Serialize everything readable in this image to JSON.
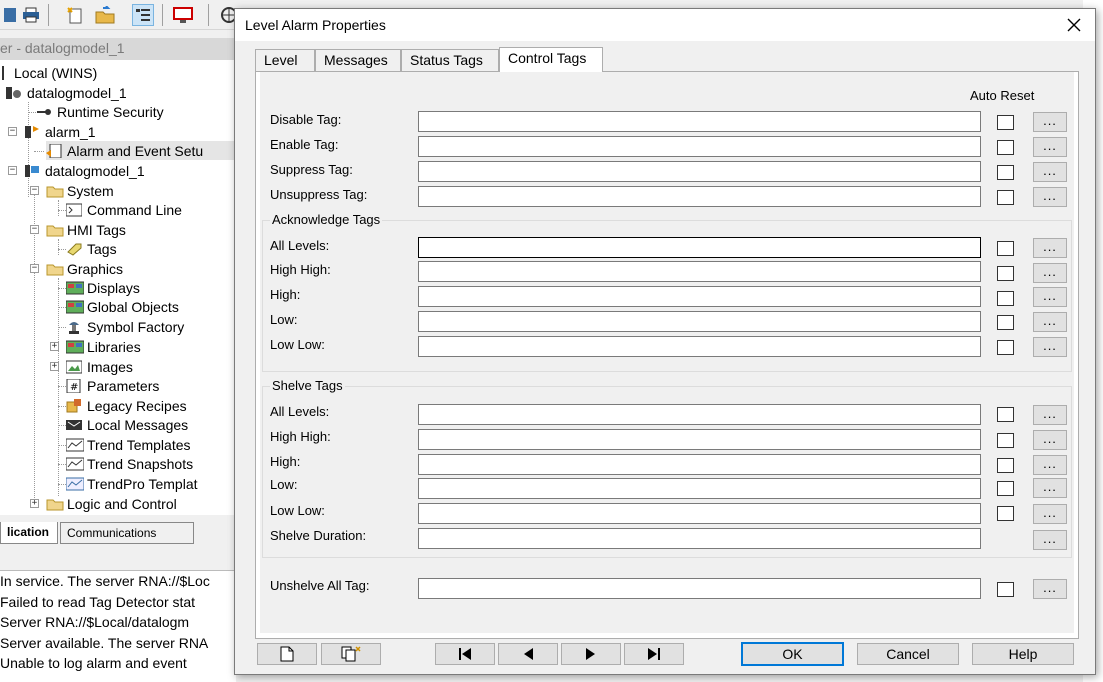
{
  "background": {
    "explorer_title": "er - datalogmodel_1",
    "tree": [
      {
        "key": "local",
        "label": "Local (WINS)"
      },
      {
        "key": "app",
        "label": "datalogmodel_1"
      },
      {
        "key": "runtime-security",
        "label": "Runtime Security"
      },
      {
        "key": "alarm",
        "label": "alarm_1"
      },
      {
        "key": "alarm-event",
        "label": "Alarm and Event Setu"
      },
      {
        "key": "area",
        "label": "datalogmodel_1"
      },
      {
        "key": "system",
        "label": "System"
      },
      {
        "key": "command-line",
        "label": "Command Line"
      },
      {
        "key": "hmi-tags",
        "label": "HMI Tags"
      },
      {
        "key": "tags",
        "label": "Tags"
      },
      {
        "key": "graphics",
        "label": "Graphics"
      },
      {
        "key": "displays",
        "label": "Displays"
      },
      {
        "key": "global-objects",
        "label": "Global Objects"
      },
      {
        "key": "symbol-factory",
        "label": "Symbol Factory"
      },
      {
        "key": "libraries",
        "label": "Libraries"
      },
      {
        "key": "images",
        "label": "Images"
      },
      {
        "key": "parameters",
        "label": "Parameters"
      },
      {
        "key": "legacy-recipes",
        "label": "Legacy Recipes"
      },
      {
        "key": "local-messages",
        "label": "Local Messages"
      },
      {
        "key": "trend-templates",
        "label": "Trend Templates"
      },
      {
        "key": "trend-snapshots",
        "label": "Trend Snapshots"
      },
      {
        "key": "trendpro-templates",
        "label": "TrendPro Templat"
      },
      {
        "key": "logic-control",
        "label": "Logic and Control"
      }
    ],
    "tabs": {
      "application": "lication",
      "communications": "Communications"
    },
    "diagnostics": [
      "In service. The server RNA://$Loc",
      "Failed to read Tag Detector stat",
      "Server RNA://$Local/datalogm",
      "Server available. The server RNA",
      "Unable to log alarm and event"
    ]
  },
  "dialog": {
    "title": "Level Alarm Properties",
    "tabs": [
      "Level",
      "Messages",
      "Status Tags",
      "Control Tags"
    ],
    "active_tab": "Control Tags",
    "auto_reset_label": "Auto Reset",
    "browse_label": "...",
    "control_fields": [
      {
        "label": "Disable Tag:",
        "value": "",
        "auto_reset": false
      },
      {
        "label": "Enable Tag:",
        "value": "",
        "auto_reset": false
      },
      {
        "label": "Suppress Tag:",
        "value": "",
        "auto_reset": false
      },
      {
        "label": "Unsuppress Tag:",
        "value": "",
        "auto_reset": false
      }
    ],
    "acknowledge_group": {
      "title": "Acknowledge Tags",
      "fields": [
        {
          "label": "All Levels:",
          "value": "",
          "auto_reset": false
        },
        {
          "label": "High High:",
          "value": "",
          "auto_reset": false
        },
        {
          "label": "High:",
          "value": "",
          "auto_reset": false
        },
        {
          "label": "Low:",
          "value": "",
          "auto_reset": false
        },
        {
          "label": "Low Low:",
          "value": "",
          "auto_reset": false
        }
      ]
    },
    "shelve_group": {
      "title": "Shelve Tags",
      "fields": [
        {
          "label": "All Levels:",
          "value": "",
          "auto_reset": false
        },
        {
          "label": "High High:",
          "value": "",
          "auto_reset": false
        },
        {
          "label": "High:",
          "value": "",
          "auto_reset": false
        },
        {
          "label": "Low:",
          "value": "",
          "auto_reset": false
        },
        {
          "label": "Low Low:",
          "value": "",
          "auto_reset": false
        }
      ],
      "duration_label": "Shelve Duration:",
      "duration_value": ""
    },
    "unshelve": {
      "label": "Unshelve All Tag:",
      "value": "",
      "auto_reset": false
    },
    "buttons": {
      "ok": "OK",
      "cancel": "Cancel",
      "help": "Help"
    }
  },
  "colors": {
    "accent": "#0078d7",
    "dialog_bg": "#f0f0f0"
  }
}
